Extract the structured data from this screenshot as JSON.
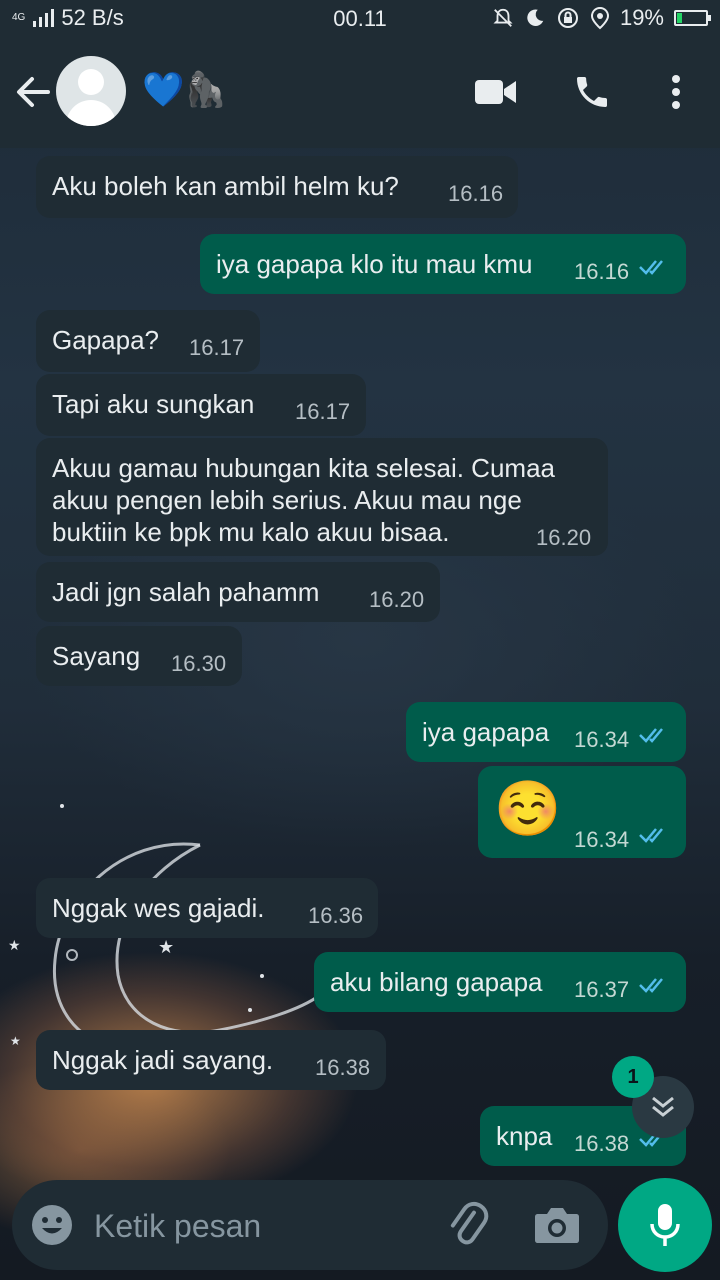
{
  "status_bar": {
    "network": "4G",
    "speed": "52 B/s",
    "time": "00.11",
    "battery": "19%",
    "battery_level": 0.19
  },
  "header": {
    "contact_name": "💙🦍"
  },
  "messages": [
    {
      "direction": "in",
      "text": "Aku boleh kan ambil helm ku?",
      "time": "16.16"
    },
    {
      "direction": "out",
      "text": "iya gapapa klo itu mau kmu",
      "time": "16.16",
      "status": "read"
    },
    {
      "direction": "in",
      "text": "Gapapa?",
      "time": "16.17"
    },
    {
      "direction": "in",
      "text": "Tapi aku sungkan",
      "time": "16.17"
    },
    {
      "direction": "in",
      "text": "Akuu gamau hubungan kita selesai. Cumaa akuu pengen lebih serius. Akuu mau nge buktiin ke bpk mu kalo akuu bisaa.",
      "time": "16.20"
    },
    {
      "direction": "in",
      "text": "Jadi jgn salah pahamm",
      "time": "16.20"
    },
    {
      "direction": "in",
      "text": "Sayang",
      "time": "16.30"
    },
    {
      "direction": "out",
      "text": "iya gapapa",
      "time": "16.34",
      "status": "read"
    },
    {
      "direction": "out",
      "text": "☺️",
      "time": "16.34",
      "status": "read"
    },
    {
      "direction": "in",
      "text": "Nggak wes gajadi.",
      "time": "16.36"
    },
    {
      "direction": "out",
      "text": "aku bilang gapapa",
      "time": "16.37",
      "status": "read"
    },
    {
      "direction": "in",
      "text": "Nggak jadi sayang.",
      "time": "16.38"
    },
    {
      "direction": "out",
      "text": "knpa",
      "time": "16.38",
      "status": "read"
    }
  ],
  "unread_count": "1",
  "composer": {
    "placeholder": "Ketik pesan"
  },
  "colors": {
    "incoming_bubble": "#1f2c34",
    "outgoing_bubble": "#005c4b",
    "accent": "#00a884",
    "read_tick": "#53bdeb"
  }
}
